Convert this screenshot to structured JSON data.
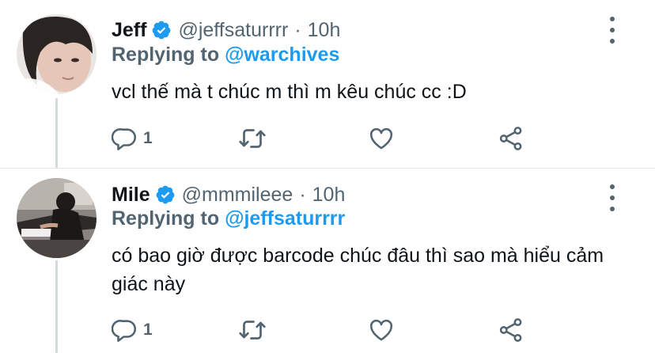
{
  "tweets": [
    {
      "name": "Jeff",
      "handle": "@jeffsaturrrr",
      "dot": "·",
      "time": "10h",
      "replying_prefix": "Replying to ",
      "replying_to": "@warchives",
      "text": "vcl thế mà t chúc m thì m kêu chúc cc :D",
      "reply_count": "1",
      "icons": [
        "reply-icon",
        "retweet-icon",
        "like-icon",
        "share-icon",
        "more-icon",
        "verified-badge-icon"
      ]
    },
    {
      "name": "Mile",
      "handle": "@mmmileee",
      "dot": "·",
      "time": "10h",
      "replying_prefix": "Replying to ",
      "replying_to": "@jeffsaturrrr",
      "text": "có bao giờ được barcode chúc đâu thì sao mà hiểu cảm giác này",
      "reply_count": "1",
      "icons": [
        "reply-icon",
        "retweet-icon",
        "like-icon",
        "share-icon",
        "more-icon",
        "verified-badge-icon"
      ]
    }
  ],
  "colors": {
    "accent": "#1d9bf0",
    "secondary_text": "#536471",
    "primary_text": "#0f1419",
    "thread_line": "#cfd9de"
  }
}
